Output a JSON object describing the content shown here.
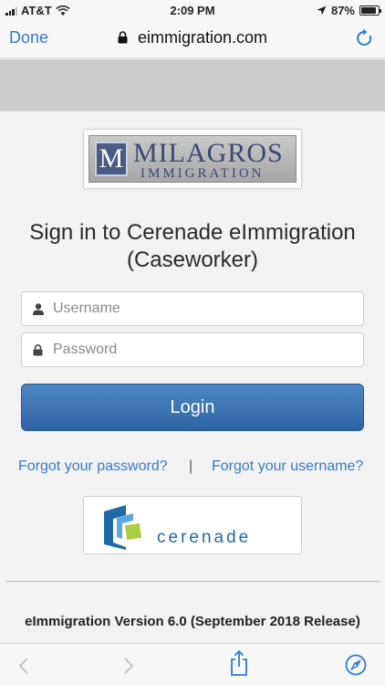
{
  "status_bar": {
    "carrier": "AT&T",
    "time": "2:09 PM",
    "battery_percent": "87%",
    "battery_level": 0.87
  },
  "browser": {
    "done_label": "Done",
    "url": "eimmigration.com"
  },
  "logo": {
    "monogram": "M",
    "name": "MILAGROS",
    "subtitle": "IMMIGRATION"
  },
  "login": {
    "title_line1": "Sign in to Cerenade eImmigration",
    "title_line2": "(Caseworker)",
    "username_placeholder": "Username",
    "password_placeholder": "Password",
    "login_label": "Login",
    "forgot_password": "Forgot your password?",
    "separator": "|",
    "forgot_username": "Forgot your username?"
  },
  "partner_logo": {
    "text": "cerenade"
  },
  "footer": {
    "version": "eImmigration Version 6.0 (September 2018 Release)"
  },
  "colors": {
    "link": "#3a7cc5",
    "button": "#3a70b0",
    "ios_blue": "#2f7ad8"
  }
}
